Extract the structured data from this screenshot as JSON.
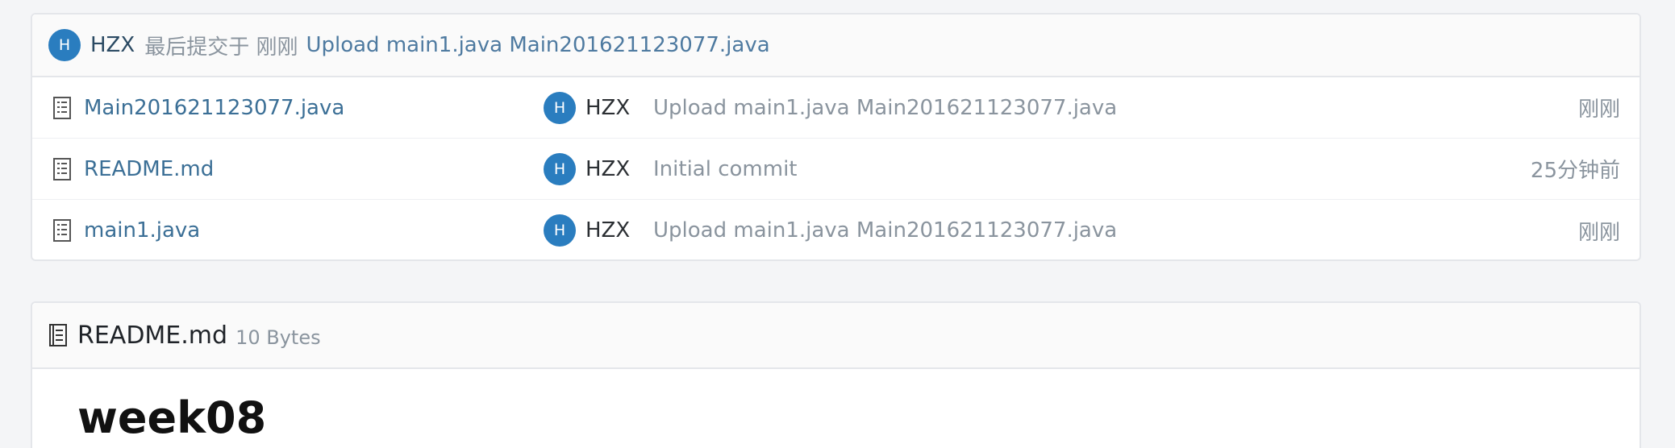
{
  "last_commit": {
    "avatar_letter": "H",
    "author": "HZX",
    "meta": "最后提交于 刚刚",
    "message": "Upload main1.java Main201621123077.java"
  },
  "files": [
    {
      "name": "Main201621123077.java",
      "avatar_letter": "H",
      "author": "HZX",
      "message": "Upload main1.java Main201621123077.java",
      "time": "刚刚"
    },
    {
      "name": "README.md",
      "avatar_letter": "H",
      "author": "HZX",
      "message": "Initial commit",
      "time": "25分钟前"
    },
    {
      "name": "main1.java",
      "avatar_letter": "H",
      "author": "HZX",
      "message": "Upload main1.java Main201621123077.java",
      "time": "刚刚"
    }
  ],
  "readme": {
    "title": "README.md",
    "size": "10 Bytes",
    "heading": "week08"
  },
  "colors": {
    "avatar": "#2a7dbf",
    "link": "#3b6f96",
    "muted": "#8a949e"
  },
  "icons": {
    "file": "file-lines-icon",
    "readme": "book-icon"
  }
}
